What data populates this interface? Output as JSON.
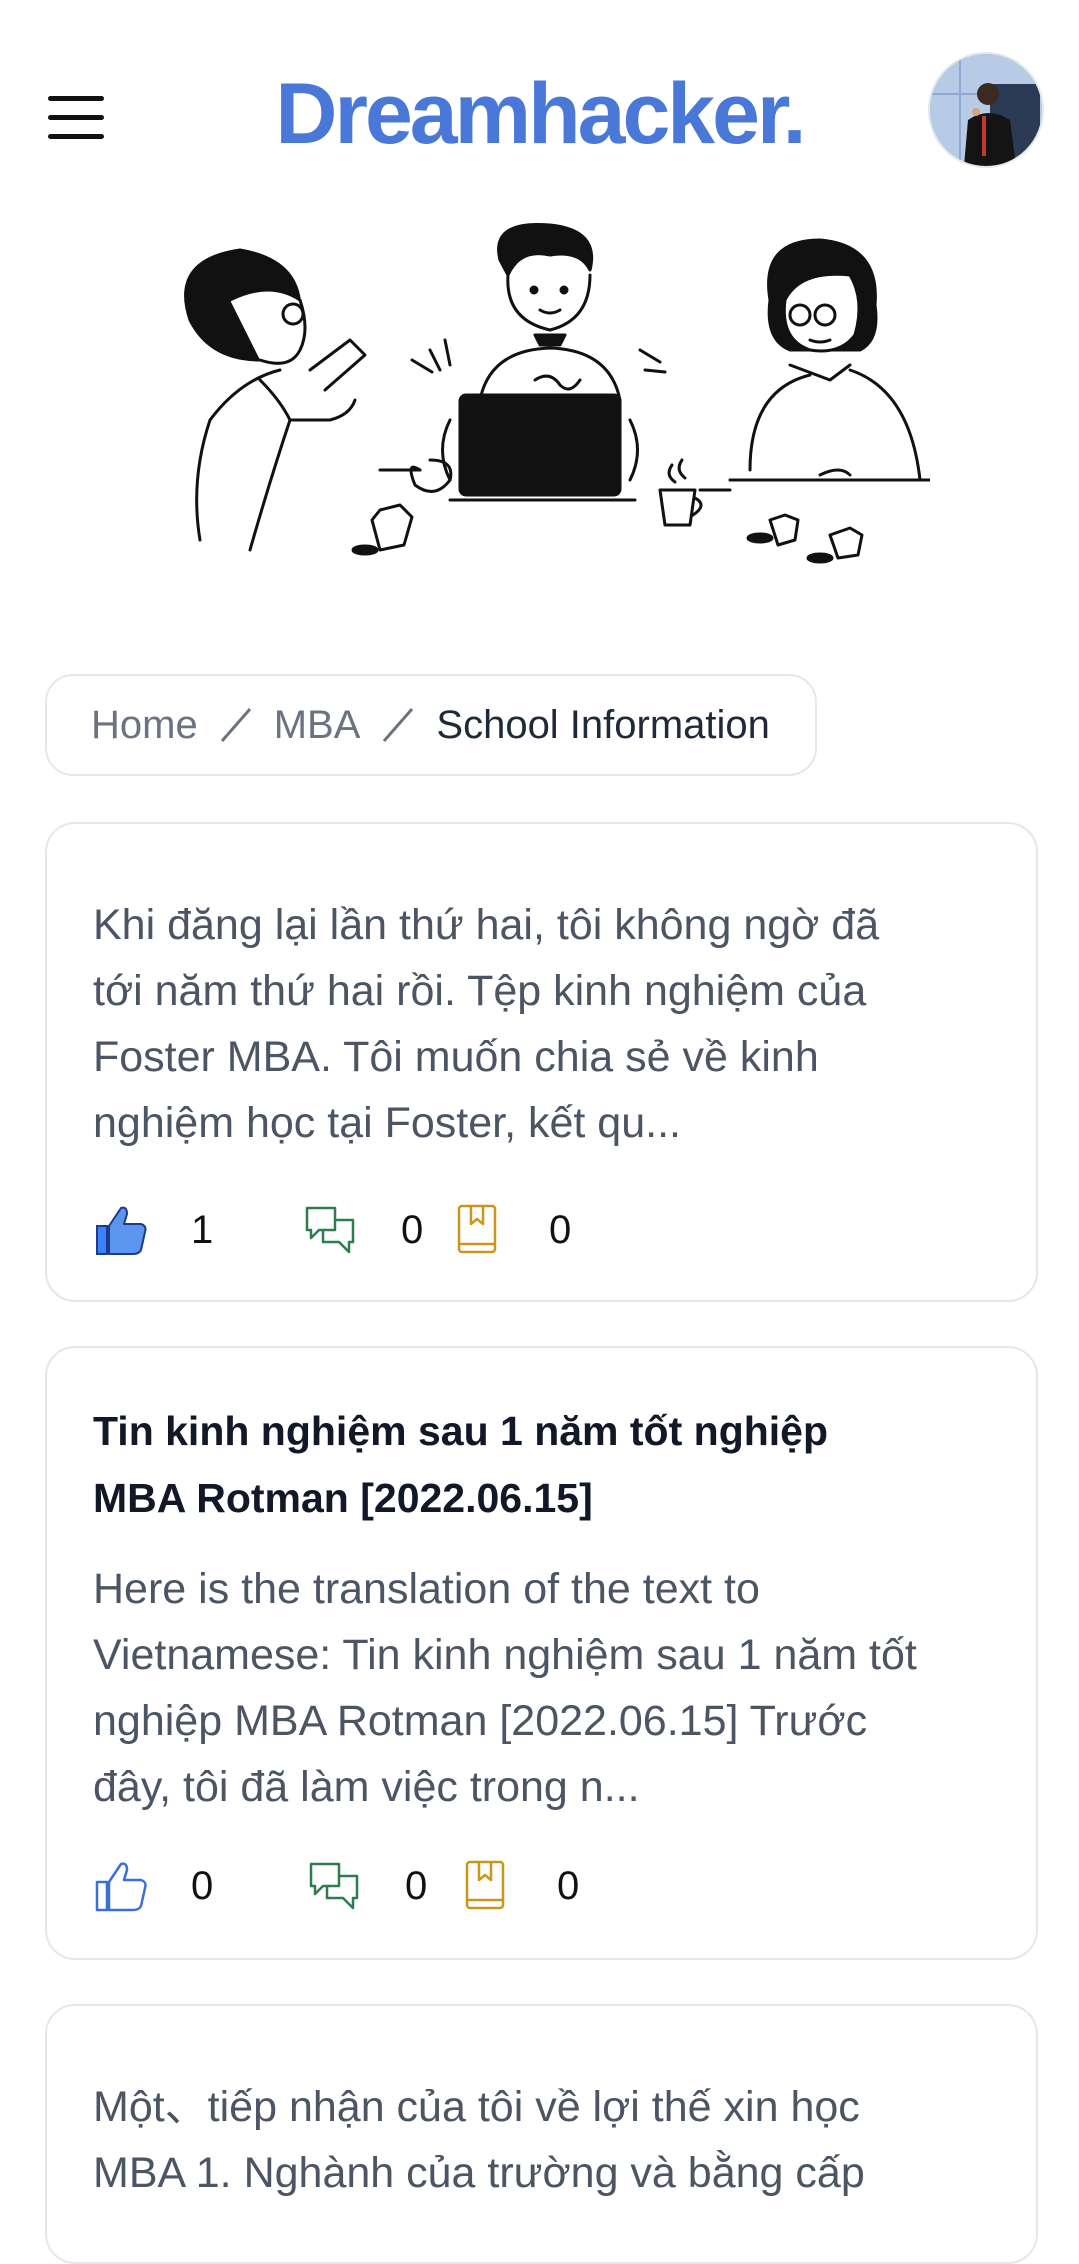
{
  "header": {
    "logo": "Dreamhacker.",
    "menu_icon": "hamburger-menu-icon",
    "avatar_alt": "user-avatar"
  },
  "colors": {
    "brand": "#4a78d8",
    "like": "#3b82f6",
    "comment": "#2e7d4f",
    "bookmark": "#c9961a",
    "border": "#e5e7eb"
  },
  "breadcrumb": {
    "items": [
      "Home",
      "MBA",
      "School Information"
    ]
  },
  "posts": [
    {
      "title": "",
      "excerpt_lines": [
        "Khi đăng lại lần thứ hai, tôi không ngờ đã",
        "tới năm thứ hai rồi. Tệp kinh nghiệm của",
        "Foster MBA. Tôi muốn chia sẻ về kinh",
        "nghiệm học tại Foster, kết qu..."
      ],
      "likes": "1",
      "comments": "0",
      "bookmarks": "0",
      "liked": true
    },
    {
      "title_lines": [
        "Tin kinh nghiệm sau 1 năm tốt nghiệp",
        "MBA Rotman [2022.06.15]"
      ],
      "excerpt_lines": [
        "Here is the translation of the text to",
        "Vietnamese: Tin kinh nghiệm sau 1 năm tốt",
        "nghiệp MBA Rotman [2022.06.15] Trước",
        "đây, tôi đã làm việc trong n..."
      ],
      "likes": "0",
      "comments": "0",
      "bookmarks": "0",
      "liked": false
    },
    {
      "title": "",
      "excerpt_lines": [
        "Một、tiếp nhận của tôi về lợi thế xin học",
        "MBA 1. Nghành của trường và bằng cấp"
      ]
    }
  ]
}
